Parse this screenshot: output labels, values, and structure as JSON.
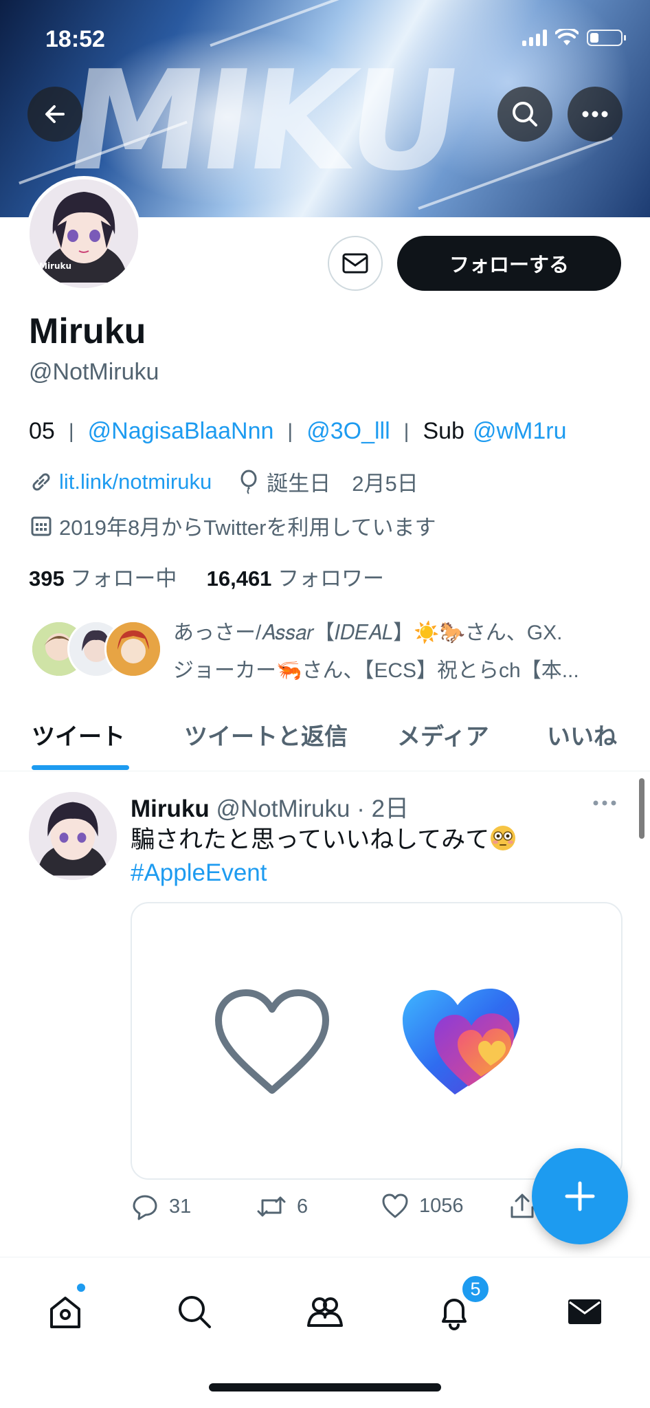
{
  "status_bar": {
    "time": "18:52"
  },
  "profile": {
    "name": "Miruku",
    "handle": "@NotMiruku",
    "follow_label": "フォローする",
    "bio": {
      "prefix": "05",
      "mention1": "@NagisaBlaaNnn",
      "mention2": "@3O_lll",
      "sub_label": "Sub",
      "mention3": "@wM1ru"
    },
    "website": "lit.link/notmiruku",
    "birthday": "誕生日　2月5日",
    "joined": "2019年8月からTwitterを利用しています",
    "following_count": "395",
    "following_label": "フォロー中",
    "followers_count": "16,461",
    "followers_label": "フォロワー",
    "followed_by_line1": "あっさー/𝐴𝑠𝑠𝑎𝑟【𝐼𝐷𝐸𝐴𝐿】☀️🐎さん、GX.",
    "followed_by_line2": "ジョーカー🦐さん、【ECS】祝とらch【本..."
  },
  "tabs": [
    "ツイート",
    "ツイートと返信",
    "メディア",
    "いいね"
  ],
  "tweet": {
    "author_name": "Miruku",
    "author_handle": "@NotMiruku",
    "time": "· 2日",
    "text": "騙されたと思っていいねしてみて",
    "hashtag": "#AppleEvent",
    "reply_count": "31",
    "retweet_count": "6",
    "like_count": "1056"
  },
  "nav": {
    "notifications_badge": "5"
  },
  "colors": {
    "accent": "#1d9bf0",
    "text": "#0f1419",
    "secondary": "#536471"
  }
}
